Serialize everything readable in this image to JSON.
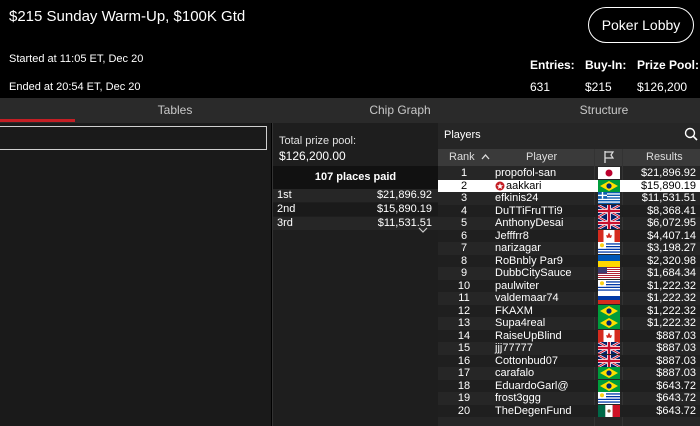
{
  "header": {
    "title": "$215 Sunday Warm-Up, $100K Gtd",
    "started": "Started at 11:05 ET, Dec 20",
    "ended": "Ended at 20:54 ET, Dec 20",
    "lobby_button": "Poker Lobby",
    "stats": [
      {
        "label": "Entries:",
        "value": "631"
      },
      {
        "label": "Buy-In:",
        "value": "$215"
      },
      {
        "label": "Prize Pool:",
        "value": "$126,200"
      }
    ]
  },
  "tabs": [
    {
      "label": "Tables",
      "active": true
    },
    {
      "label": "Chip Graph",
      "active": false
    },
    {
      "label": "Structure",
      "active": false
    }
  ],
  "prize": {
    "total_label": "Total prize pool:",
    "total_value": "$126,200.00",
    "places_paid": "107 places paid",
    "places": [
      {
        "place": "1st",
        "amount": "$21,896.92"
      },
      {
        "place": "2nd",
        "amount": "$15,890.19"
      },
      {
        "place": "3rd",
        "amount": "$11,531.51"
      }
    ]
  },
  "players": {
    "title": "Players",
    "columns": {
      "rank": "Rank",
      "player": "Player",
      "results": "Results"
    },
    "rows": [
      {
        "rank": "1",
        "name": "propofol-san",
        "flag": "japan",
        "result": "$21,896.92"
      },
      {
        "rank": "2",
        "name": "aakkari",
        "flag": "brazil",
        "result": "$15,890.19",
        "highlight": true,
        "badge": "pokerstars-logo-icon"
      },
      {
        "rank": "3",
        "name": "efkinis24",
        "flag": "greece",
        "result": "$11,531.51"
      },
      {
        "rank": "4",
        "name": "DuTTiFruTTi9",
        "flag": "uk",
        "result": "$8,368.41"
      },
      {
        "rank": "5",
        "name": "AnthonyDesai",
        "flag": "uk",
        "result": "$6,072.95"
      },
      {
        "rank": "6",
        "name": "Jefffrr8",
        "flag": "canada",
        "result": "$4,407.14"
      },
      {
        "rank": "7",
        "name": "narizagar",
        "flag": "uruguay",
        "result": "$3,198.27"
      },
      {
        "rank": "8",
        "name": "RoBnbly Par9",
        "flag": "ukraine",
        "result": "$2,320.98"
      },
      {
        "rank": "9",
        "name": "DubbCitySauce",
        "flag": "usa",
        "result": "$1,684.34"
      },
      {
        "rank": "10",
        "name": "paulwiter",
        "flag": "uruguay",
        "result": "$1,222.32"
      },
      {
        "rank": "11",
        "name": "valdemaar74",
        "flag": "russia",
        "result": "$1,222.32"
      },
      {
        "rank": "12",
        "name": "FKAXM",
        "flag": "brazil",
        "result": "$1,222.32"
      },
      {
        "rank": "13",
        "name": "Supa4real",
        "flag": "brazil",
        "result": "$1,222.32"
      },
      {
        "rank": "14",
        "name": "RaiseUpBlind",
        "flag": "canada",
        "result": "$887.03"
      },
      {
        "rank": "15",
        "name": "jjj77777",
        "flag": "uk",
        "result": "$887.03"
      },
      {
        "rank": "16",
        "name": "Cottonbud07",
        "flag": "uk",
        "result": "$887.03"
      },
      {
        "rank": "17",
        "name": "carafalo",
        "flag": "brazil",
        "result": "$887.03"
      },
      {
        "rank": "18",
        "name": "EduardoGarl@",
        "flag": "brazil",
        "result": "$643.72"
      },
      {
        "rank": "19",
        "name": "frost3ggg",
        "flag": "uruguay",
        "result": "$643.72"
      },
      {
        "rank": "20",
        "name": "TheDegenFund",
        "flag": "mexico",
        "result": "$643.72"
      }
    ]
  },
  "colors": {
    "accent": "#c41e24",
    "highlight_row": "#ffffff",
    "panel": "#262626"
  }
}
